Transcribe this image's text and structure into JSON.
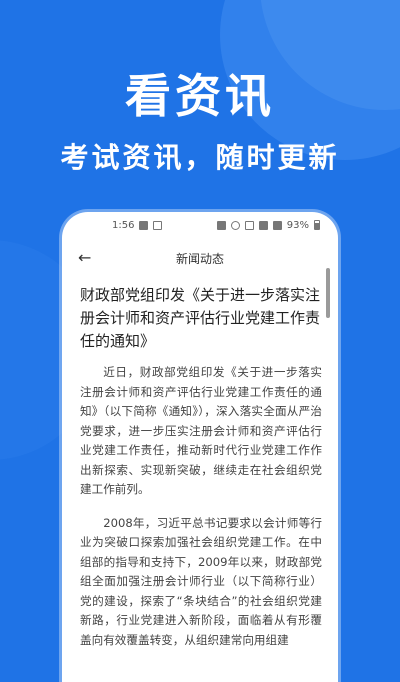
{
  "hero": {
    "title": "看资讯",
    "subtitle": "考试资讯，随时更新"
  },
  "status_bar": {
    "time": "1:56",
    "battery": "93%"
  },
  "nav": {
    "title": "新闻动态"
  },
  "article": {
    "title": "财政部党组印发《关于进一步落实注册会计师和资产评估行业党建工作责任的通知》",
    "paragraphs": [
      "近日，财政部党组印发《关于进一步落实注册会计师和资产评估行业党建工作责任的通知》（以下简称《通知》），深入落实全面从严治党要求，进一步压实注册会计师和资产评估行业党建工作责任，推动新时代行业党建工作作出新探索、实现新突破，继续走在社会组织党建工作前列。",
      "2008年，习近平总书记要求以会计师等行业为突破口探索加强社会组织党建工作。在中组部的指导和支持下，2009年以来，财政部党组全面加强注册会计师行业（以下简称行业）党的建设，探索了“条块结合”的社会组织党建新路，行业党建进入新阶段，面临着从有形覆盖向有效覆盖转变，从组织建常向用组建"
    ]
  },
  "colors": {
    "background": "#1f73e6",
    "card": "#ffffff"
  }
}
